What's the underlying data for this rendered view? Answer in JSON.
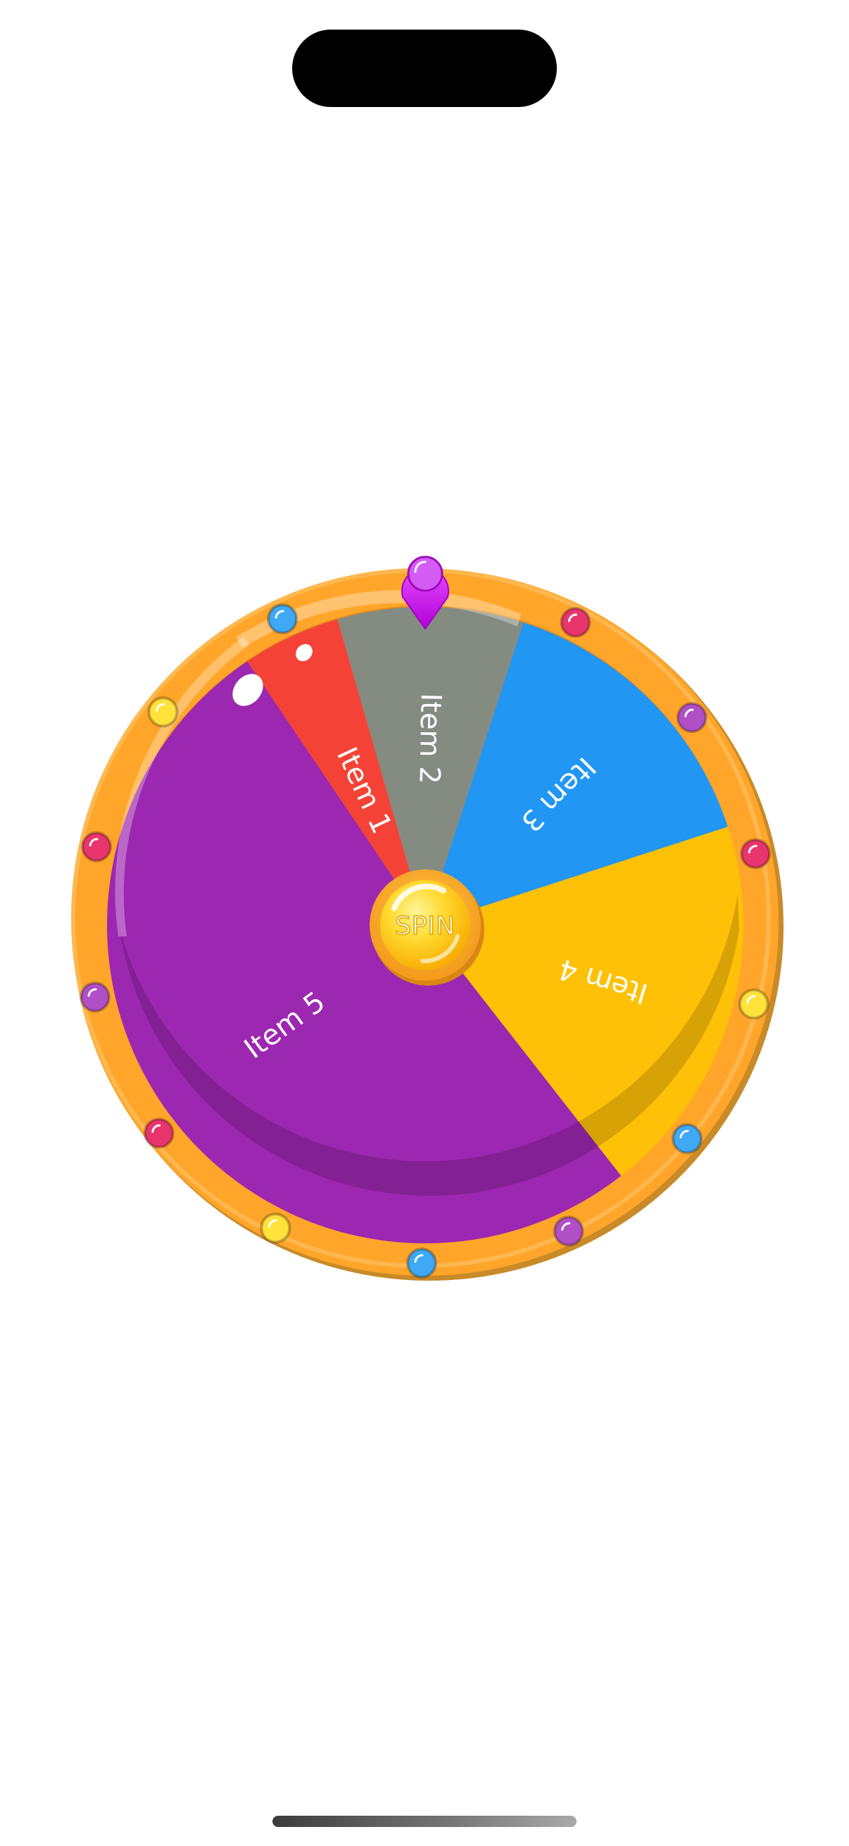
{
  "wheel": {
    "spin_label": "SPIN",
    "segments": [
      {
        "label": "Item 1",
        "color": "#F44336"
      },
      {
        "label": "Item 2",
        "color": "#848C82"
      },
      {
        "label": "Item 3",
        "color": "#2196F3"
      },
      {
        "label": "Item 4",
        "color": "#FFC107"
      },
      {
        "label": "Item 5",
        "color": "#9C27B0"
      }
    ],
    "rim_color": "#FFA52A",
    "pointer_color": "#CC00E6",
    "bulb_colors": [
      "#3FA9F5",
      "#FFE23A",
      "#E8356D",
      "#B04FC6"
    ]
  }
}
